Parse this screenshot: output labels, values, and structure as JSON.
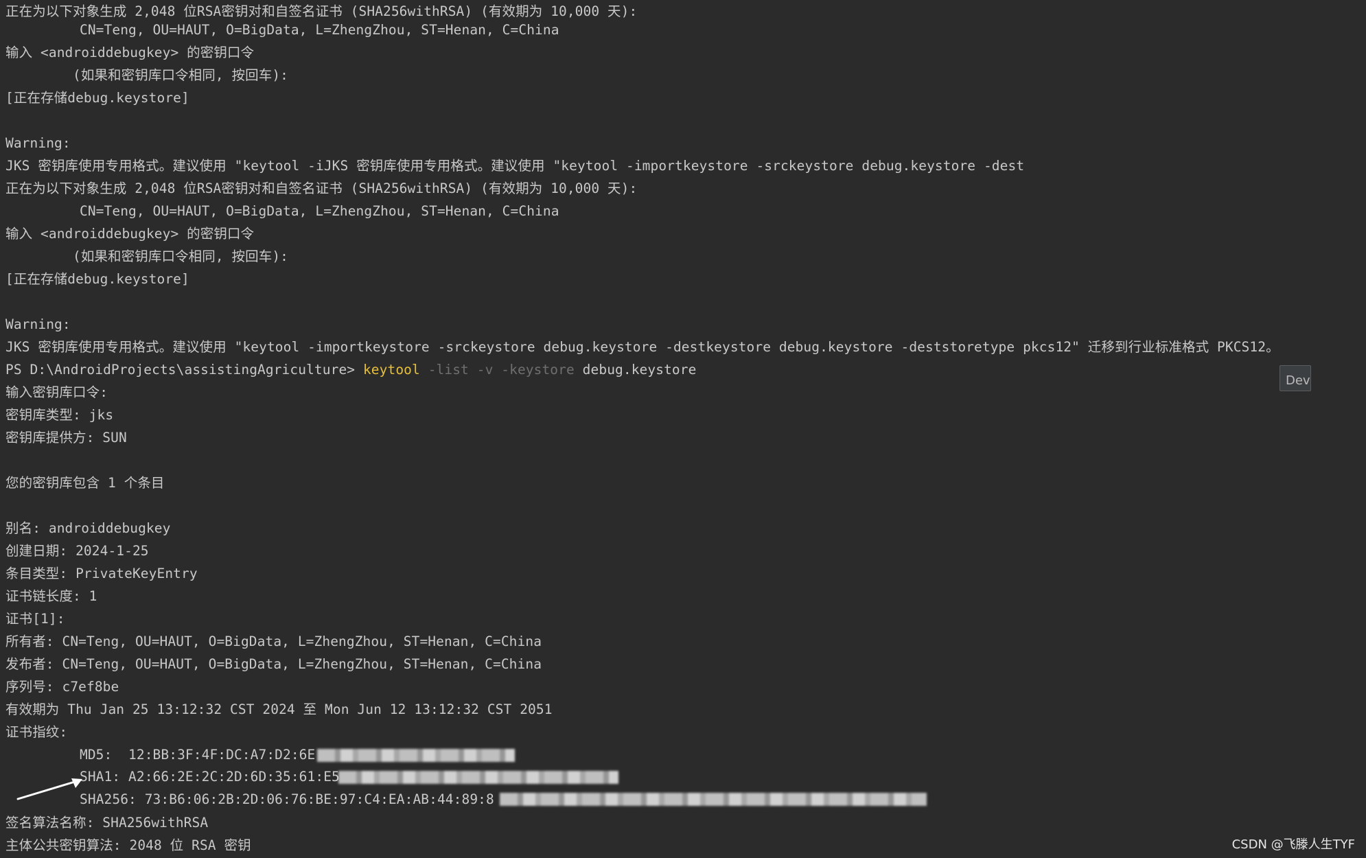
{
  "terminal": {
    "lines": [
      "正在为以下对象生成 2,048 位RSA密钥对和自签名证书 (SHA256withRSA) (有效期为 10,000 天):",
      "CN=Teng, OU=HAUT, O=BigData, L=ZhengZhou, ST=Henan, C=China",
      "输入 <androiddebugkey> 的密钥口令",
      "(如果和密钥库口令相同, 按回车):",
      "[正在存储debug.keystore]",
      "",
      "Warning:",
      "JKS 密钥库使用专用格式。建议使用 \"keytool -iJKS 密钥库使用专用格式。建议使用 \"keytool -importkeystore -srckeystore debug.keystore -dest",
      "正在为以下对象生成 2,048 位RSA密钥对和自签名证书 (SHA256withRSA) (有效期为 10,000 天):",
      "CN=Teng, OU=HAUT, O=BigData, L=ZhengZhou, ST=Henan, C=China",
      "输入 <androiddebugkey> 的密钥口令",
      "(如果和密钥库口令相同, 按回车):",
      "[正在存储debug.keystore]",
      "",
      "Warning:",
      "JKS 密钥库使用专用格式。建议使用 \"keytool -importkeystore -srckeystore debug.keystore -destkeystore debug.keystore -deststoretype pkcs12\" 迁移到行业标准格式 PKCS12。"
    ],
    "prompt": {
      "path": "PS D:\\AndroidProjects\\assistingAgriculture> ",
      "command": "keytool",
      "flags": " -list -v -keystore",
      "arg": " debug.keystore"
    },
    "output": [
      "输入密钥库口令:",
      "密钥库类型: jks",
      "密钥库提供方: SUN",
      "",
      "您的密钥库包含 1 个条目",
      "",
      "别名: androiddebugkey",
      "创建日期: 2024-1-25",
      "条目类型: PrivateKeyEntry",
      "证书链长度: 1",
      "证书[1]:",
      "所有者: CN=Teng, OU=HAUT, O=BigData, L=ZhengZhou, ST=Henan, C=China",
      "发布者: CN=Teng, OU=HAUT, O=BigData, L=ZhengZhou, ST=Henan, C=China",
      "序列号: c7ef8be",
      "有效期为 Thu Jan 25 13:12:32 CST 2024 至 Mon Jun 12 13:12:32 CST 2051",
      "证书指纹:"
    ],
    "fingerprints": {
      "md5": "MD5:  12:BB:3F:4F:DC:A7:D2:6E",
      "sha1": "SHA1: A2:66:2E:2C:2D:6D:35:61:E5",
      "sha256": "SHA256: 73:B6:06:2B:2D:06:76:BE:97:C4:EA:AB:44:89:8"
    },
    "footer": [
      "签名算法名称: SHA256withRSA",
      "主体公共密钥算法: 2048 位 RSA 密钥"
    ]
  },
  "dev_button": {
    "label": "Dev"
  },
  "watermark": "CSDN @飞滕人生TYF",
  "colors": {
    "background": "#2b2b2b",
    "text": "#c9c9c9",
    "command": "#e8bf3a",
    "flag": "#6f6f6f"
  }
}
